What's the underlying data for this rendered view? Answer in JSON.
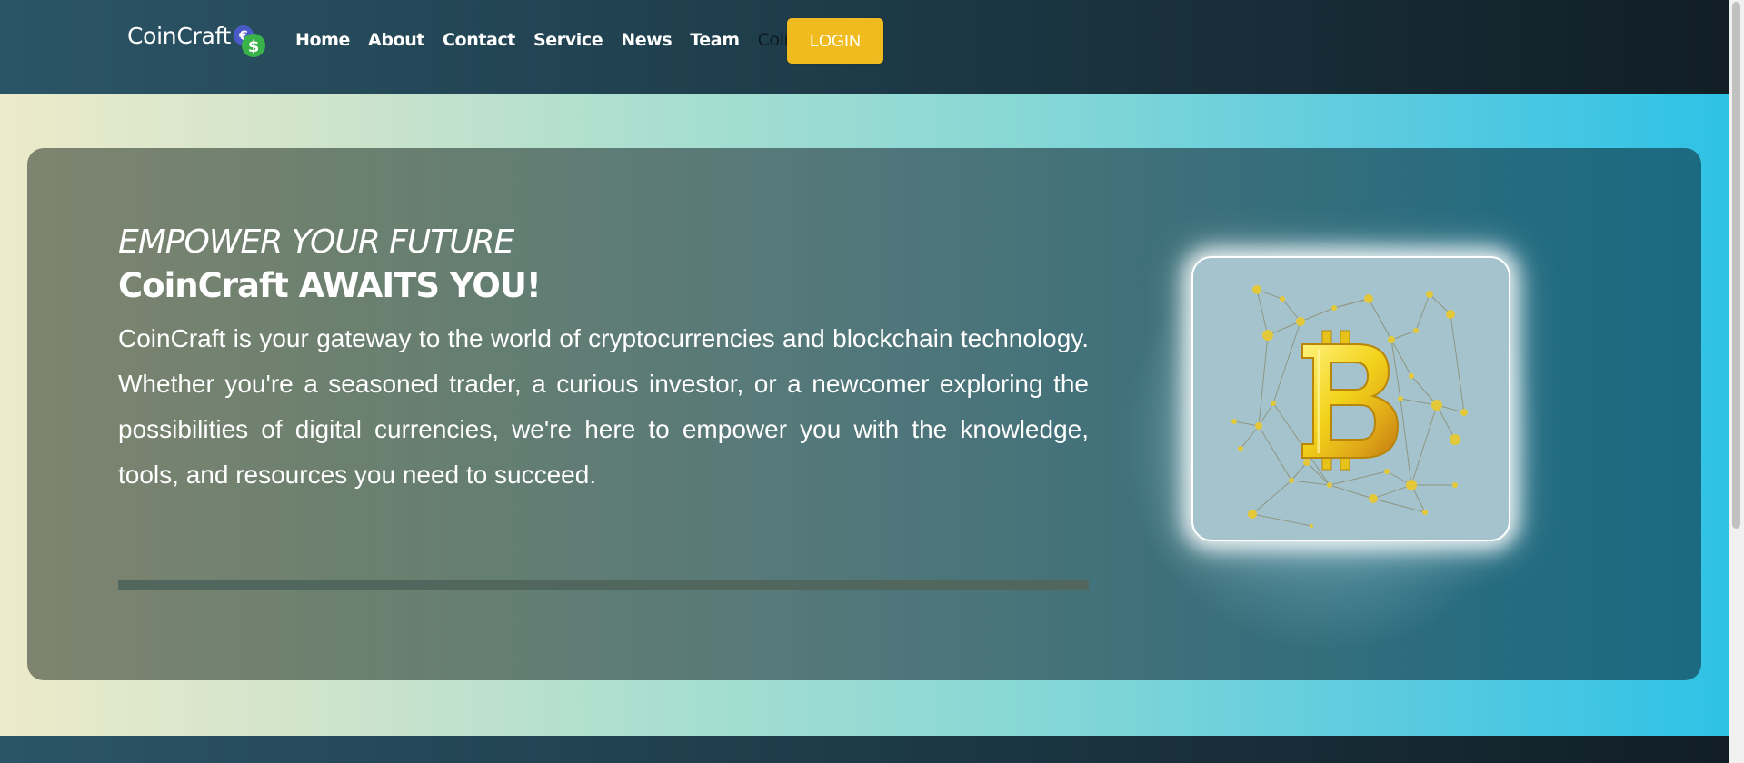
{
  "brand": {
    "name": "CoinCraft"
  },
  "nav": {
    "items": [
      {
        "label": "Home"
      },
      {
        "label": "About"
      },
      {
        "label": "Contact"
      },
      {
        "label": "Service"
      },
      {
        "label": "News"
      },
      {
        "label": "Team"
      }
    ],
    "dropdown_label": "Coins",
    "login_label": "LOGIN"
  },
  "hero": {
    "subtitle": "EMPOWER YOUR FUTURE",
    "title": "CoinCraft AWAITS YOU!",
    "description": "CoinCraft is your gateway to the world of cryptocurrencies and blockchain technology. Whether you're a seasoned trader, a curious investor, or a newcomer exploring the possibilities of digital currencies, we're here to empower you with the knowledge, tools, and resources you need to succeed.",
    "image_icon": "bitcoin-network-illustration"
  },
  "colors": {
    "accent": "#f0bb1e",
    "nav_bg": "#1d3a48",
    "card_bg": "#3c6f7a",
    "image_bg": "#a5c3cc"
  }
}
